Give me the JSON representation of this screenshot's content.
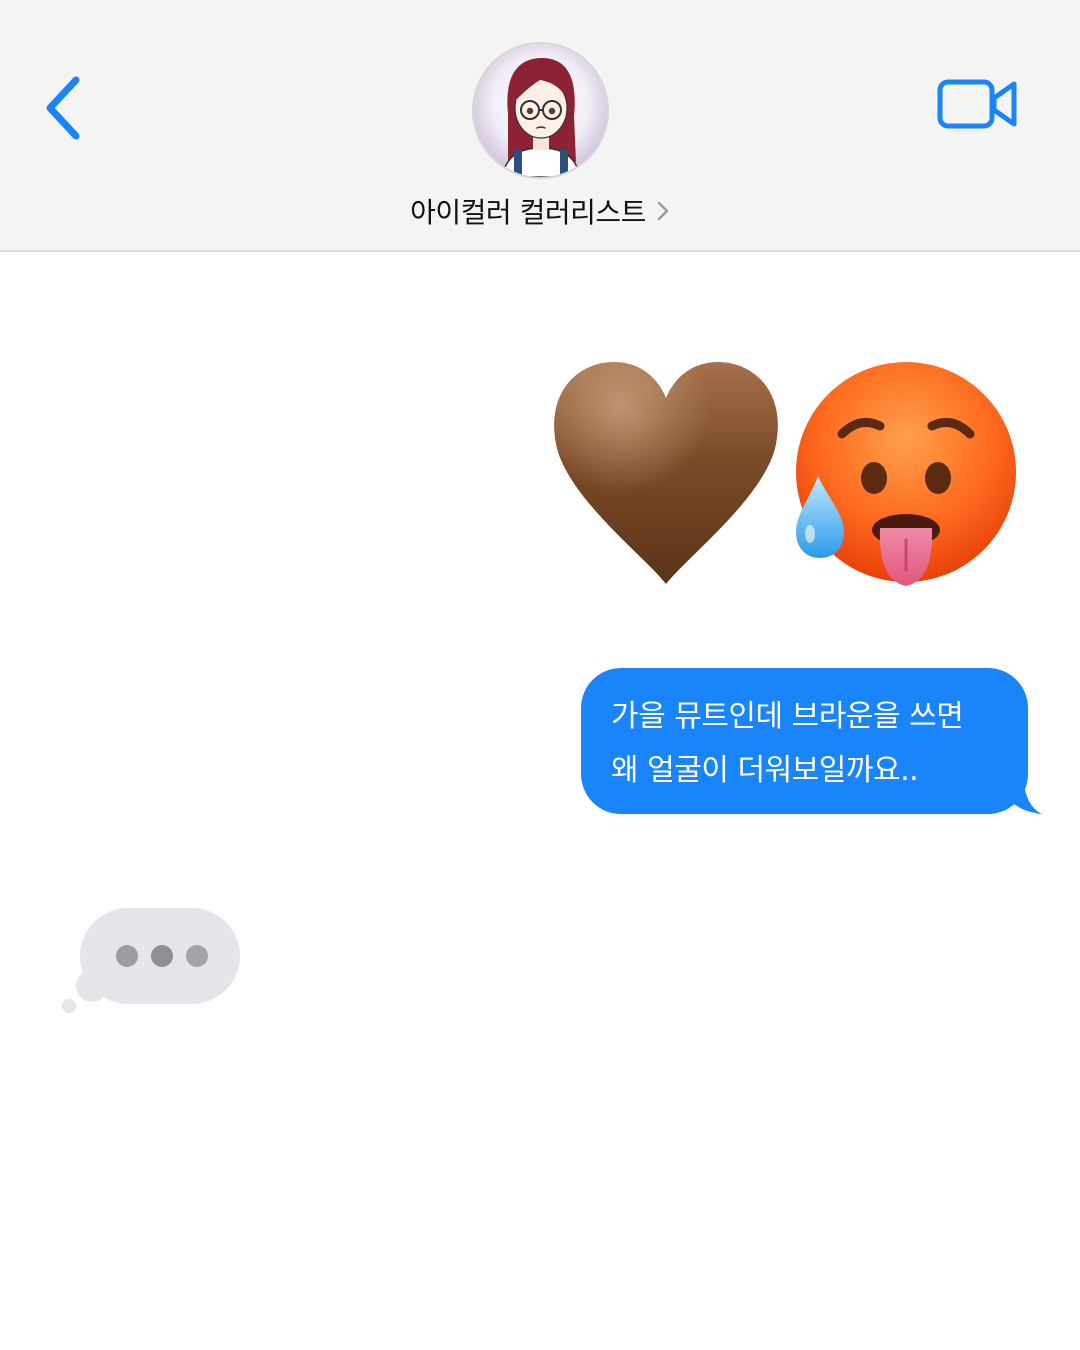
{
  "header": {
    "contact_name": "아이컬러 컬러리스트",
    "back_icon": "chevron-left-icon",
    "video_icon": "video-camera-icon",
    "detail_icon": "chevron-right-icon"
  },
  "colors": {
    "accent": "#1a84fb",
    "header_bg": "#f4f4f4",
    "typing_bubble": "#e5e5ea",
    "typing_dot": "#8e8e93"
  },
  "messages": [
    {
      "direction": "outgoing",
      "type": "emoji",
      "emojis": [
        "brown-heart-icon",
        "hot-face-icon"
      ]
    },
    {
      "direction": "outgoing",
      "type": "text",
      "lines": [
        "가을 뮤트인데 브라운을 쓰면",
        "왜 얼굴이 더워보일까요.."
      ]
    },
    {
      "direction": "incoming",
      "type": "typing-indicator"
    }
  ]
}
